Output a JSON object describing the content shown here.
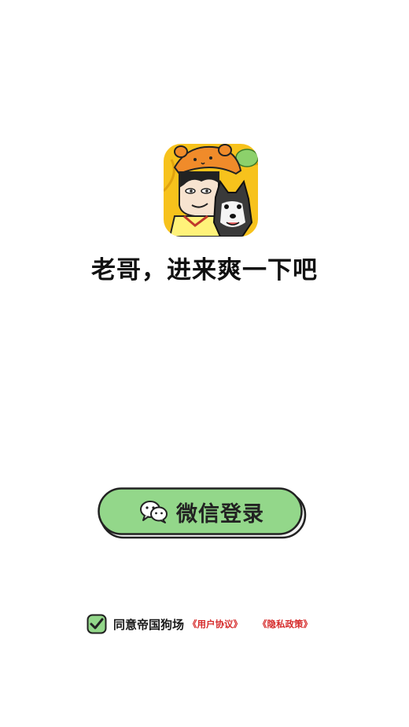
{
  "app": {
    "icon_name": "app-logo-icon",
    "slogan": "老哥，进来爽一下吧"
  },
  "login": {
    "wechat_label": "微信登录",
    "button_color": "#93d78a",
    "icon_name": "wechat-icon"
  },
  "agreement": {
    "checked": true,
    "text": "同意帝国狗场",
    "user_agreement": "《用户协议》",
    "privacy_policy": "《隐私政策》",
    "link_color": "#d62b2b"
  }
}
